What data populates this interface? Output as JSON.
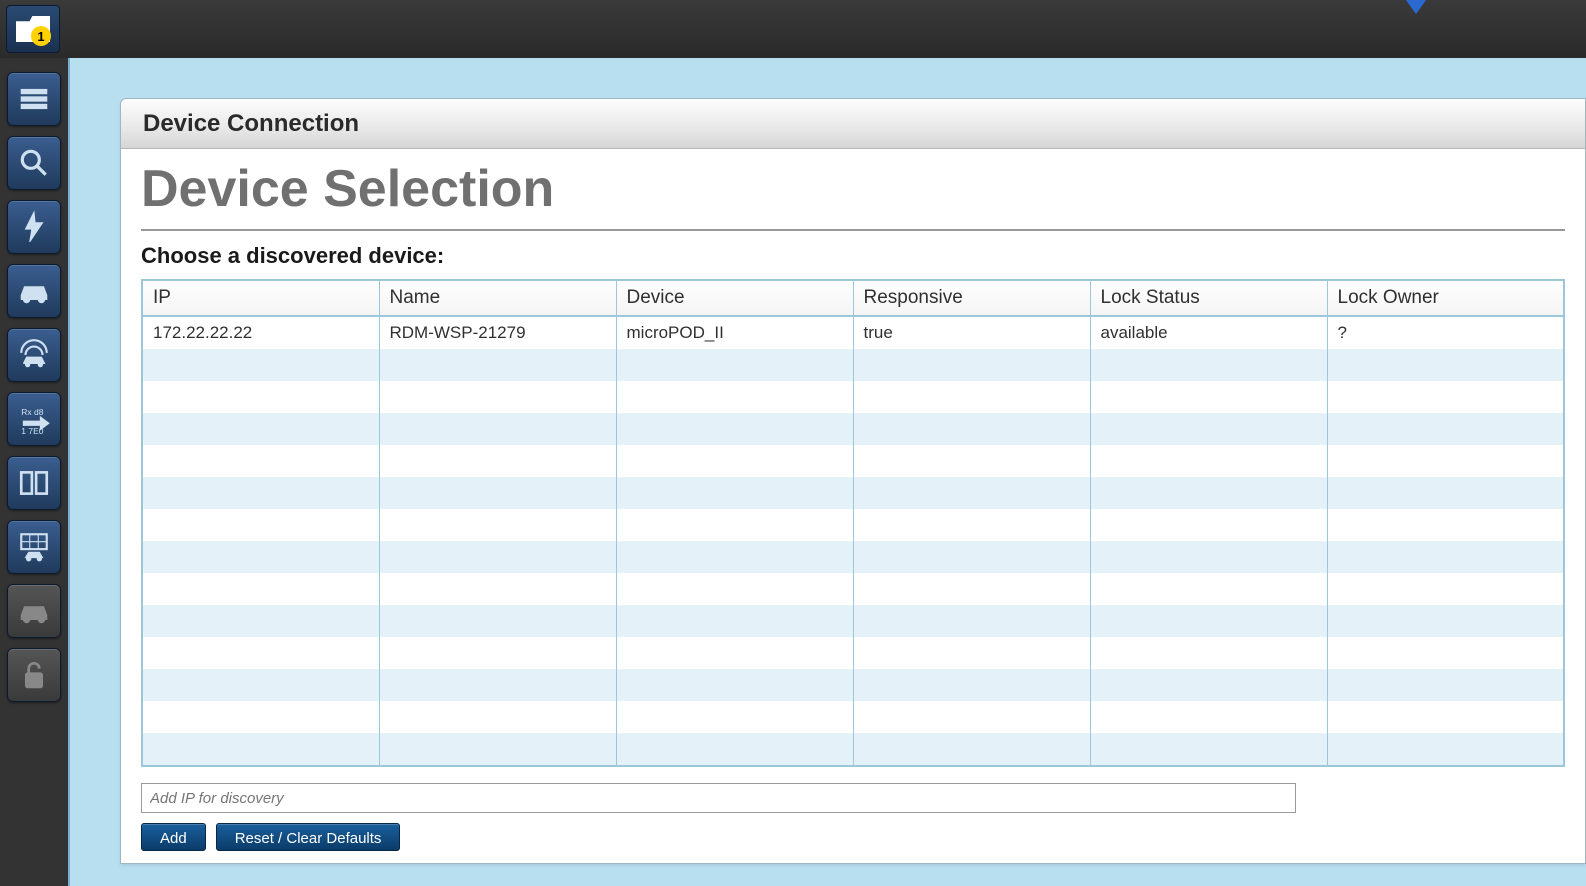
{
  "topbar": {
    "folder_count": "1"
  },
  "sidebar": {
    "items": [
      {
        "name": "menu-icon"
      },
      {
        "name": "vehicle-search-icon"
      },
      {
        "name": "flash-icon"
      },
      {
        "name": "vehicle-icon"
      },
      {
        "name": "wireless-vehicle-icon"
      },
      {
        "name": "data-transfer-icon"
      },
      {
        "name": "compare-panel-icon"
      },
      {
        "name": "vehicle-grid-icon"
      },
      {
        "name": "vehicle-disabled-icon",
        "disabled": true
      },
      {
        "name": "lock-icon",
        "disabled": true
      }
    ]
  },
  "panel": {
    "header": "Device Connection",
    "title": "Device Selection",
    "subtitle": "Choose a discovered device:"
  },
  "table": {
    "columns": [
      "IP",
      "Name",
      "Device",
      "Responsive",
      "Lock Status",
      "Lock Owner"
    ],
    "rows": [
      {
        "ip": "172.22.22.22",
        "name": "RDM-WSP-21279",
        "device": "microPOD_II",
        "responsive": "true",
        "lock_status": "available",
        "lock_owner": "?"
      }
    ],
    "empty_rows": 13
  },
  "ip_input": {
    "placeholder": "Add IP for discovery"
  },
  "buttons": {
    "add": "Add",
    "reset": "Reset / Clear Defaults"
  }
}
